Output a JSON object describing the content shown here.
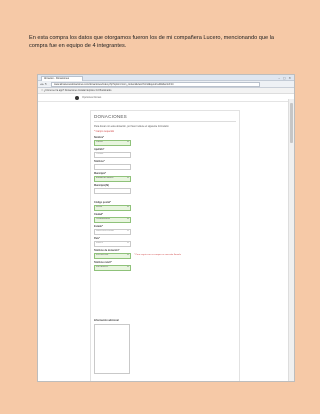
{
  "caption": "En esta compra los datos que otorgamos fueron los de mi compañera Lucero, mencionando que la compra fue en equipo de 4 integrantes.",
  "browser": {
    "tab_title": "Almacén - Donaciones",
    "window_buttons": "– ▢ ✕",
    "nav_glyphs": "◂ ▸ ↻",
    "url": "www.almacenesdonaciones.com/donaciones/index.php?option=com_content&view=form&layout=edit&Itemid=14",
    "bookmarks": "☆ ¿Cómo ser la app?   Donaciones   Instalar Explorer 10   Bookmarks"
  },
  "site_nav": {
    "label": "Opciones Donac."
  },
  "form": {
    "title": "DONACIONES",
    "intro": "Para donar con esta donación, por favor rellene el siguiente formulario",
    "required_note": "* Campo requerido",
    "fields": [
      {
        "label": "Nombre*",
        "value": "Lucero"
      },
      {
        "label": "Apellido*",
        "value": "Castillo"
      },
      {
        "label": "Teléfono*",
        "value": ""
      },
      {
        "label": "Municipio*",
        "value": "Estado de México"
      },
      {
        "label": "Municipio(Si)",
        "value": ""
      },
      {
        "label": "Código postal*",
        "value": "56335"
      },
      {
        "label": "Ciudad*",
        "value": "Chimalhuacán"
      },
      {
        "label": "Estado*",
        "value": "Selecciona estado"
      },
      {
        "label": "País*",
        "value": "México"
      },
      {
        "label": "Teléfono de donación*",
        "value": "5512347856"
      },
      {
        "label": "Teléfono móvil*",
        "value": "5567894512"
      },
      {
        "label": "Información adicional"
      }
    ],
    "phone_hint": "* Para seguir con su compra se necesita llenarlo"
  },
  "colors": {
    "page_background": "#f6c9a7",
    "valid_field": "#e8f5df",
    "required_red": "#d04a4a"
  }
}
